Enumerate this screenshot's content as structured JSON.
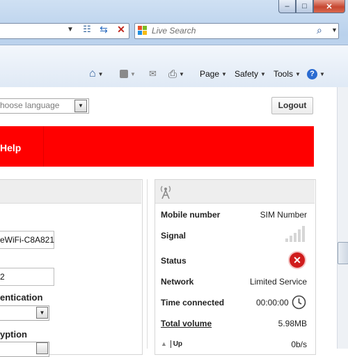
{
  "window": {
    "buttons": [
      "minimize",
      "maximize",
      "close"
    ]
  },
  "address_bar": {
    "buttons": [
      "dropdown",
      "compatibility",
      "refresh",
      "stop"
    ]
  },
  "search": {
    "placeholder": "Live Search"
  },
  "command_bar": {
    "items": [
      {
        "icon": "home-icon"
      },
      {
        "icon": "rss-icon"
      },
      {
        "icon": "mail-icon"
      },
      {
        "icon": "print-icon"
      },
      {
        "label": "Page"
      },
      {
        "label": "Safety"
      },
      {
        "label": "Tools"
      },
      {
        "icon": "help-icon"
      }
    ]
  },
  "top": {
    "language_placeholder": "hoose language",
    "logout_label": "Logout"
  },
  "nav": {
    "help_label": "Help"
  },
  "wifi_settings": {
    "ssid_value": "eWiFi-C8A821",
    "number_value": "2",
    "authentication_label": "entication",
    "encryption_label": "yption"
  },
  "status_panel": {
    "rows": {
      "mobile_number": {
        "label": "Mobile number",
        "value": "SIM Number"
      },
      "signal": {
        "label": "Signal",
        "bars": 0
      },
      "status": {
        "label": "Status",
        "state": "error"
      },
      "network": {
        "label": "Network",
        "value": "Limited Service"
      },
      "time_connected": {
        "label": "Time connected",
        "value": "00:00:00"
      },
      "total_volume": {
        "label": "Total volume",
        "value": "5.98MB"
      },
      "up": {
        "label": "Up",
        "value": "0b/s"
      }
    }
  },
  "colors": {
    "accent_red": "#ff0000",
    "error": "#d01c1c"
  }
}
